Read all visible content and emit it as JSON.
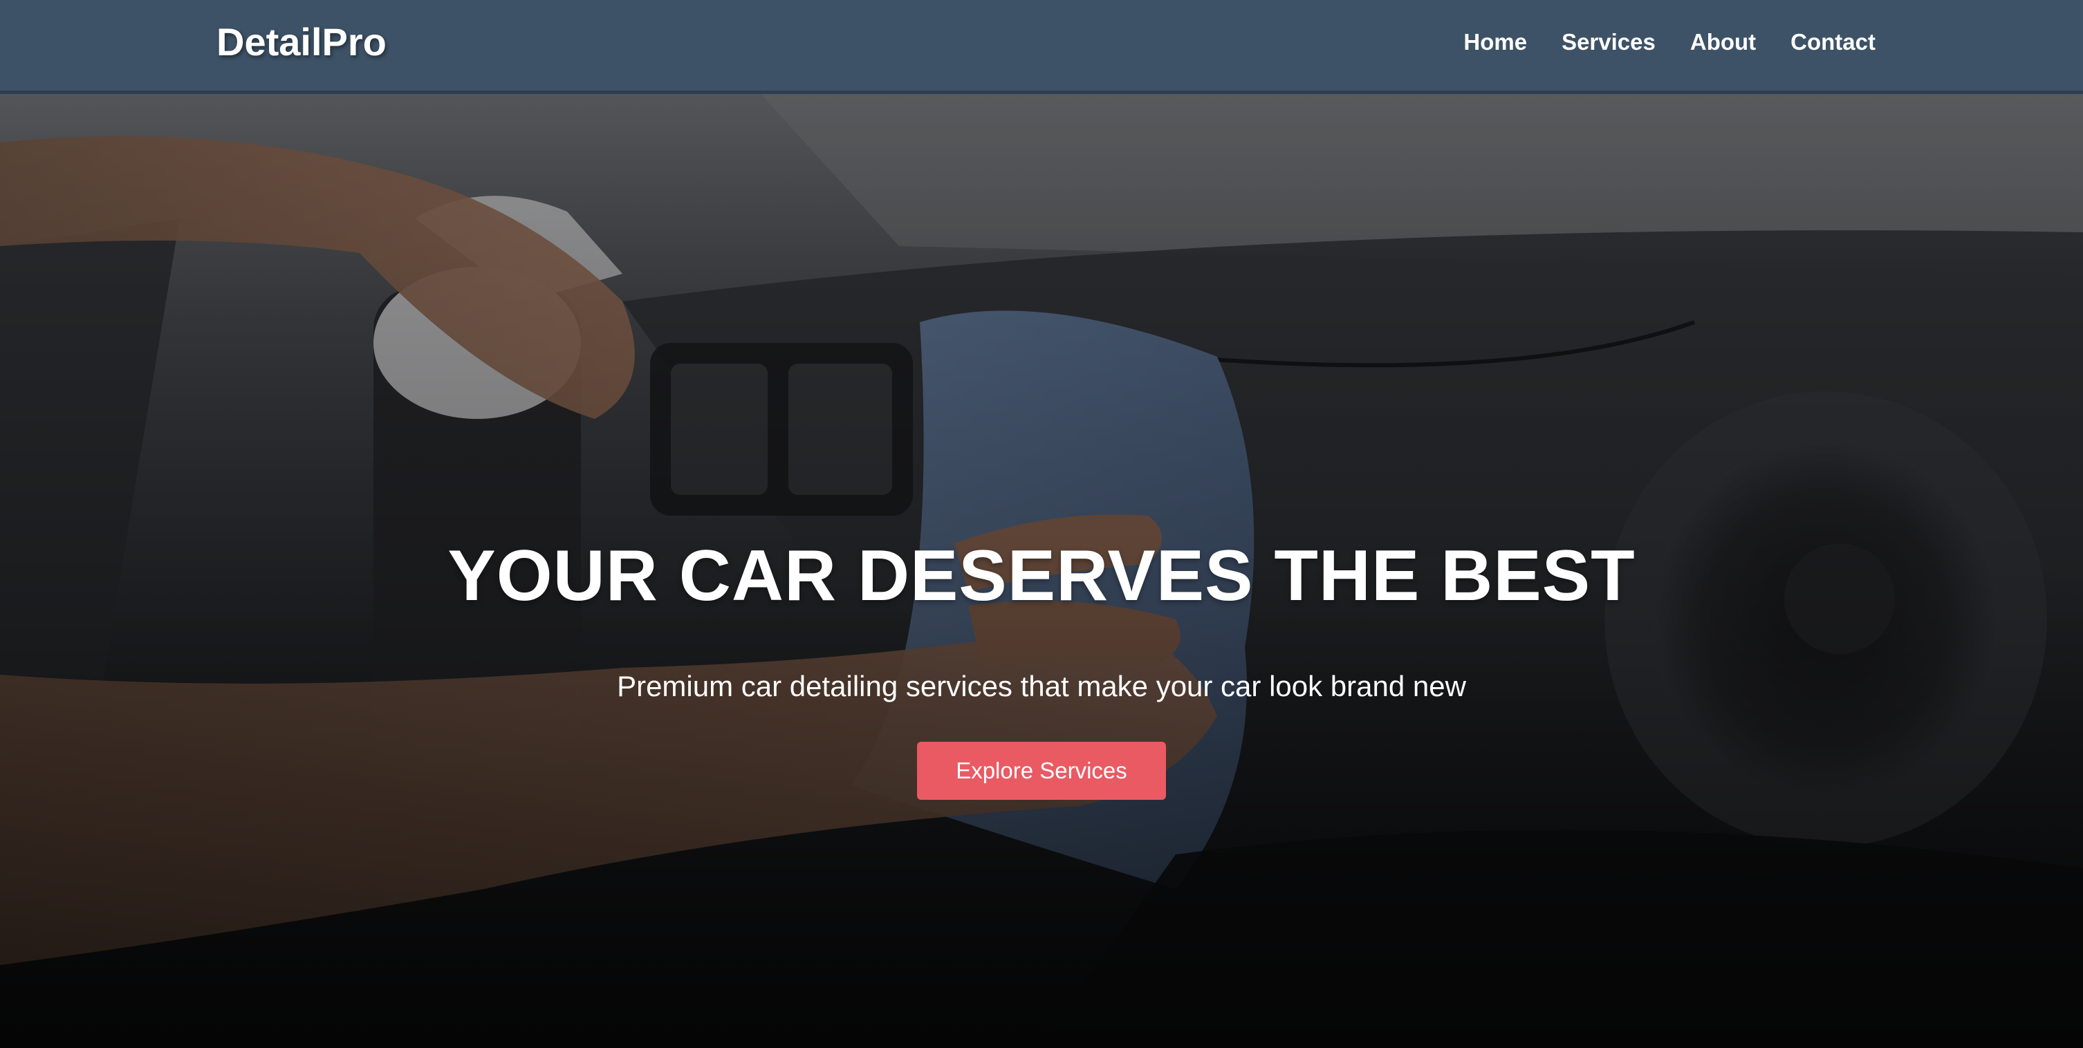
{
  "brand": {
    "name": "DetailPro"
  },
  "nav": {
    "items": [
      {
        "label": "Home"
      },
      {
        "label": "Services"
      },
      {
        "label": "About"
      },
      {
        "label": "Contact"
      }
    ]
  },
  "hero": {
    "title": "YOUR CAR DESERVES THE BEST",
    "subtitle": "Premium car detailing services that make your car look brand new",
    "cta_label": "Explore Services"
  },
  "colors": {
    "navbar": "#3d5266",
    "accent": "#ea5a63",
    "text": "#ffffff"
  }
}
